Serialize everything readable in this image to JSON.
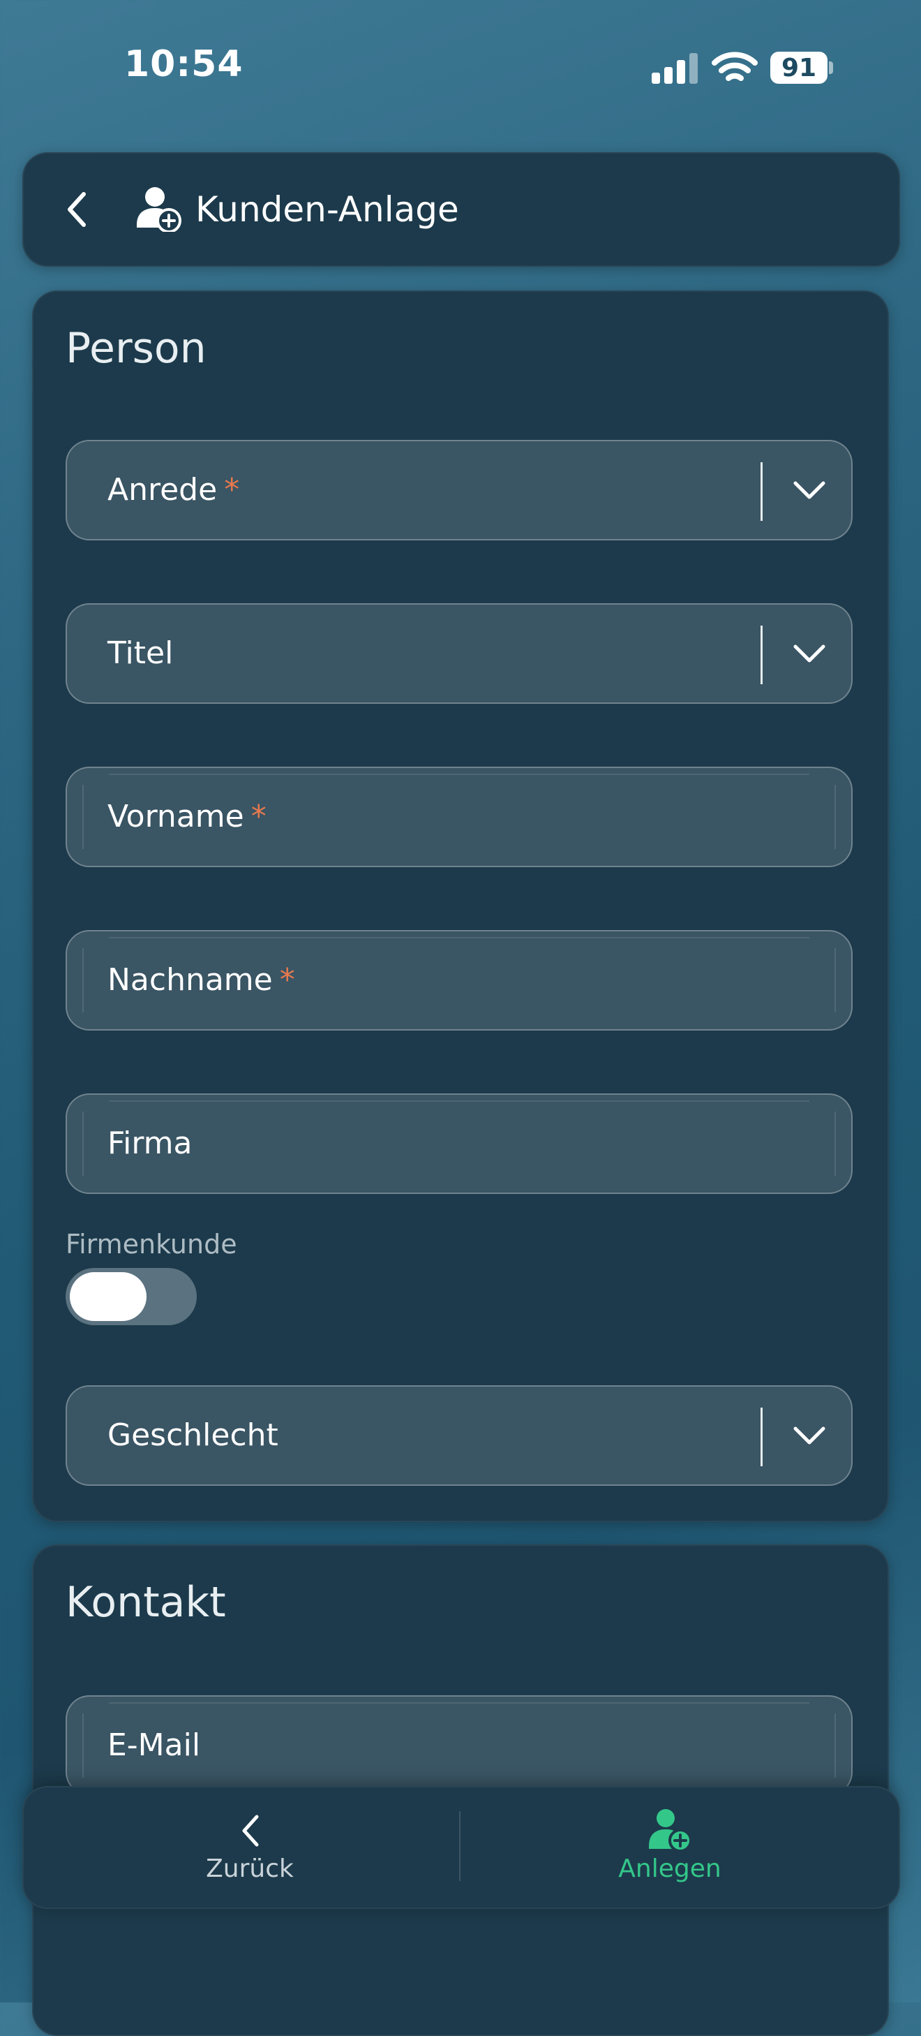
{
  "status_bar": {
    "time": "10:54",
    "battery": "91"
  },
  "header": {
    "title": "Kunden-Anlage",
    "back_icon": "chevron-left-icon",
    "title_icon": "add-user-icon"
  },
  "person": {
    "title": "Person",
    "fields": {
      "anrede": {
        "label": "Anrede",
        "required": "*"
      },
      "titel": {
        "label": "Titel"
      },
      "vorname": {
        "label": "Vorname",
        "required": "*"
      },
      "nachname": {
        "label": "Nachname",
        "required": "*"
      },
      "firma": {
        "label": "Firma"
      },
      "geschlecht": {
        "label": "Geschlecht"
      }
    },
    "firmenkunde": {
      "label": "Firmenkunde",
      "on": false
    }
  },
  "contact": {
    "title": "Kontakt",
    "fields": {
      "email": {
        "label": "E-Mail"
      }
    }
  },
  "bottom_bar": {
    "back_label": "Zurück",
    "create_label": "Anlegen"
  },
  "colors": {
    "accent": "#34c78a",
    "required": "#e8794e",
    "panel": "#1c3a4b",
    "field": "#3a5564"
  }
}
